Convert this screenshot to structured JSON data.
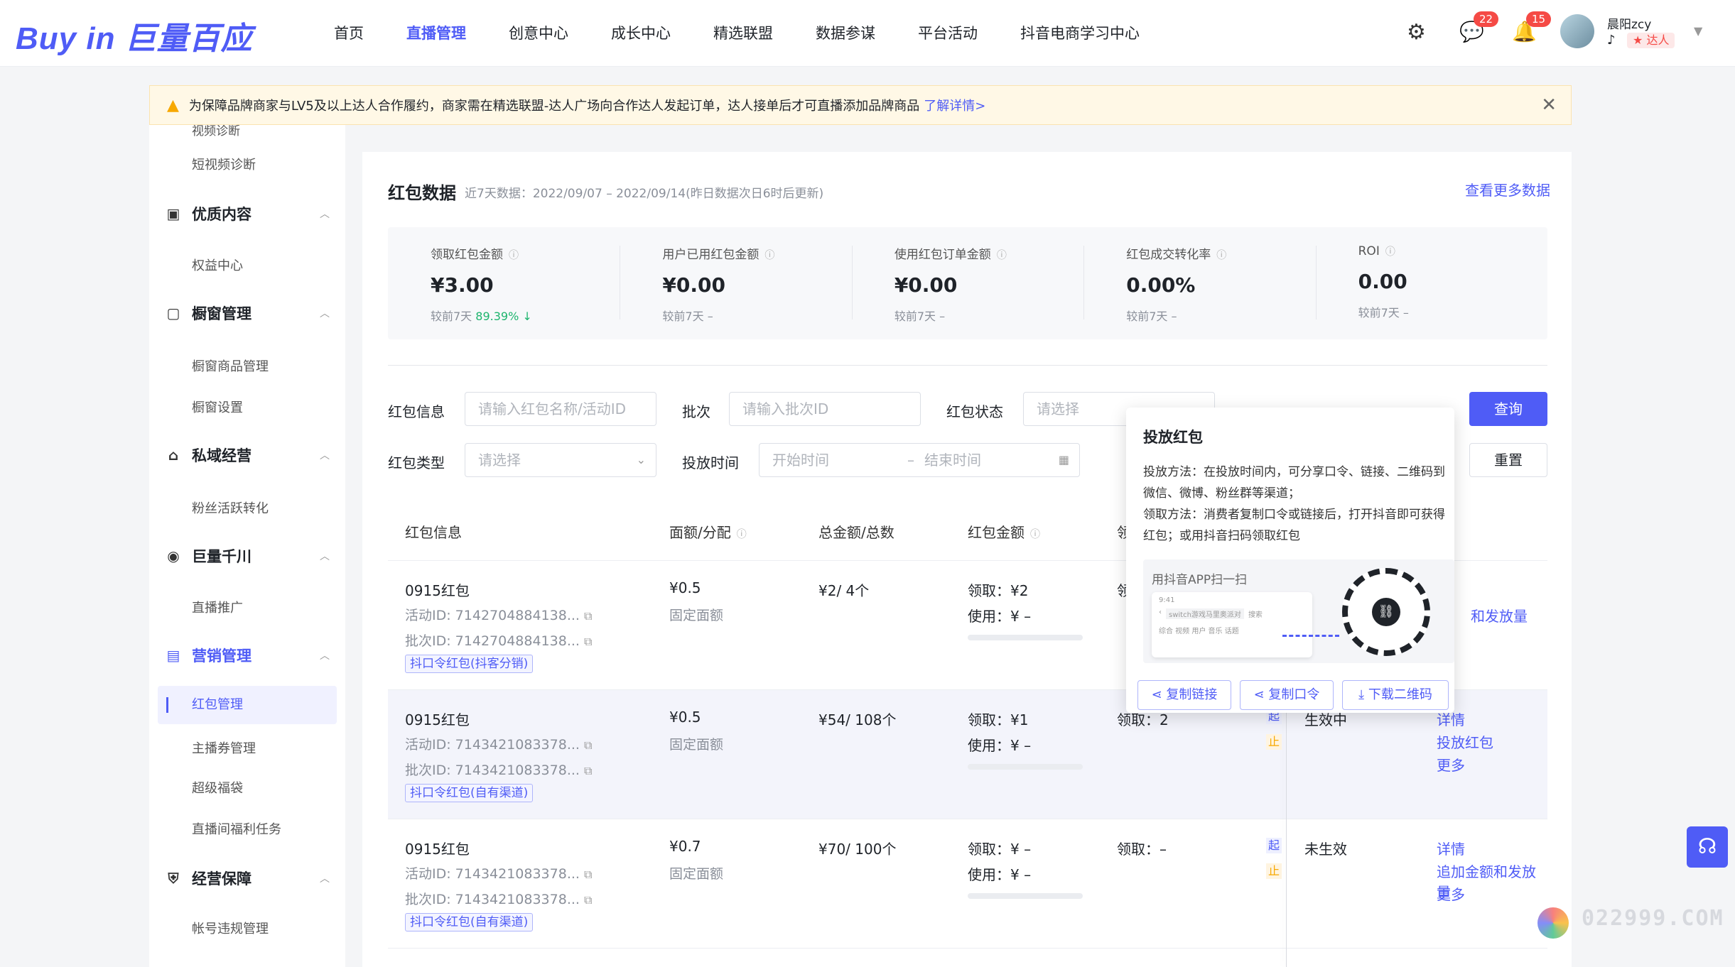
{
  "header": {
    "logo": "Buy in 巨量百应",
    "nav": [
      "首页",
      "直播管理",
      "创意中心",
      "成长中心",
      "精选联盟",
      "数据参谋",
      "平台活动",
      "抖音电商学习中心"
    ],
    "active_nav": "直播管理",
    "messages_badge": "22",
    "notifications_badge": "15",
    "username": "晨阳zcy",
    "role": "达人"
  },
  "notice": {
    "text": "为保障品牌商家与LV5及以上达人合作履约，商家需在精选联盟-达人广场向合作达人发起订单，达人接单后才可直播添加品牌商品",
    "link": "了解详情>"
  },
  "sidebar": {
    "partial_top": "视频诊断",
    "items": [
      {
        "type": "item",
        "label": "短视频诊断"
      },
      {
        "type": "group",
        "label": "优质内容",
        "icon": "content-icon"
      },
      {
        "type": "item",
        "label": "权益中心"
      },
      {
        "type": "group",
        "label": "橱窗管理",
        "icon": "window-icon"
      },
      {
        "type": "item",
        "label": "橱窗商品管理"
      },
      {
        "type": "item",
        "label": "橱窗设置"
      },
      {
        "type": "group",
        "label": "私域经营",
        "icon": "private-icon"
      },
      {
        "type": "item",
        "label": "粉丝活跃转化"
      },
      {
        "type": "group",
        "label": "巨量千川",
        "icon": "qianchuan-icon"
      },
      {
        "type": "item",
        "label": "直播推广"
      },
      {
        "type": "group",
        "label": "营销管理",
        "icon": "marketing-icon",
        "active": true
      },
      {
        "type": "item",
        "label": "红包管理",
        "active": true
      },
      {
        "type": "item",
        "label": "主播券管理"
      },
      {
        "type": "item",
        "label": "超级福袋"
      },
      {
        "type": "item",
        "label": "直播间福利任务"
      },
      {
        "type": "group",
        "label": "经营保障",
        "icon": "guarantee-icon"
      },
      {
        "type": "item",
        "label": "帐号违规管理"
      }
    ]
  },
  "section": {
    "title": "红包数据",
    "subtitle": "近7天数据：2022/09/07 – 2022/09/14(昨日数据次日6时后更新)",
    "more_link": "查看更多数据"
  },
  "stats": [
    {
      "label": "领取红包金额",
      "value": "¥3.00",
      "compare_label": "较前7天",
      "compare_value": "89.39%",
      "trend": "↓"
    },
    {
      "label": "用户已用红包金额",
      "value": "¥0.00",
      "compare_label": "较前7天",
      "compare_value": "–",
      "trend": ""
    },
    {
      "label": "使用红包订单金额",
      "value": "¥0.00",
      "compare_label": "较前7天",
      "compare_value": "–",
      "trend": ""
    },
    {
      "label": "红包成交转化率",
      "value": "0.00%",
      "compare_label": "较前7天",
      "compare_value": "–",
      "trend": ""
    },
    {
      "label": "ROI",
      "value": "0.00",
      "compare_label": "较前7天",
      "compare_value": "–",
      "trend": ""
    }
  ],
  "filters": {
    "hongbao_info_label": "红包信息",
    "hongbao_info_placeholder": "请输入红包名称/活动ID",
    "batch_label": "批次",
    "batch_placeholder": "请输入批次ID",
    "status_label": "红包状态",
    "status_placeholder": "请选择",
    "type_label": "红包类型",
    "type_placeholder": "请选择",
    "time_label": "投放时间",
    "start_placeholder": "开始时间",
    "end_placeholder": "结束时间",
    "query_button": "查询",
    "reset_button": "重置"
  },
  "table": {
    "headers": [
      "红包信息",
      "面额/分配",
      "总金额/总数",
      "红包金额",
      "领"
    ],
    "rows": [
      {
        "name": "0915红包",
        "activity_id": "活动ID: 7142704884138...",
        "batch_id": "批次ID: 7142704884138...",
        "tag": "抖口令红包(抖客分销)",
        "face": "¥0.5",
        "alloc": "固定面额",
        "total": "¥2/ 4个",
        "receive": "领取：¥2",
        "use": "使用：¥ –",
        "col5": "领",
        "status": "",
        "ops": [
          "和发放量"
        ]
      },
      {
        "name": "0915红包",
        "activity_id": "活动ID: 7143421083378...",
        "batch_id": "批次ID: 7143421083378...",
        "tag": "抖口令红包(自有渠道)",
        "face": "¥0.5",
        "alloc": "固定面额",
        "total": "¥54/ 108个",
        "receive": "领取：¥1",
        "use": "使用：¥ –",
        "col5": "领取：2",
        "status": "生效中",
        "ops": [
          "详情",
          "投放红包",
          "更多"
        ]
      },
      {
        "name": "0915红包",
        "activity_id": "活动ID: 7143421083378...",
        "batch_id": "批次ID: 7143421083378...",
        "tag": "抖口令红包(自有渠道)",
        "face": "¥0.7",
        "alloc": "固定面额",
        "total": "¥70/ 100个",
        "receive": "领取：¥ –",
        "use": "使用：¥ –",
        "col5": "领取：–",
        "status": "未生效",
        "ops": [
          "详情",
          "追加金额和发放量",
          "更多"
        ]
      }
    ],
    "start_tag": "起",
    "stop_tag": "止"
  },
  "popover": {
    "title": "投放红包",
    "method": "投放方法：在投放时间内，可分享口令、链接、二维码到微信、微博、粉丝群等渠道；",
    "receive_method": "领取方法：消费者复制口令或链接后，打开抖音即可获得红包；或用抖音扫码领取红包",
    "qr_label": "用抖音APP扫一扫",
    "phone_time": "9:41",
    "phone_search": "switch游戏马里奥派对",
    "phone_search_btn": "搜索",
    "phone_tabs": "综合  视频  用户  音乐  话题",
    "buttons": [
      "复制链接",
      "复制口令",
      "下载二维码"
    ]
  },
  "watermark": "022999.COM"
}
